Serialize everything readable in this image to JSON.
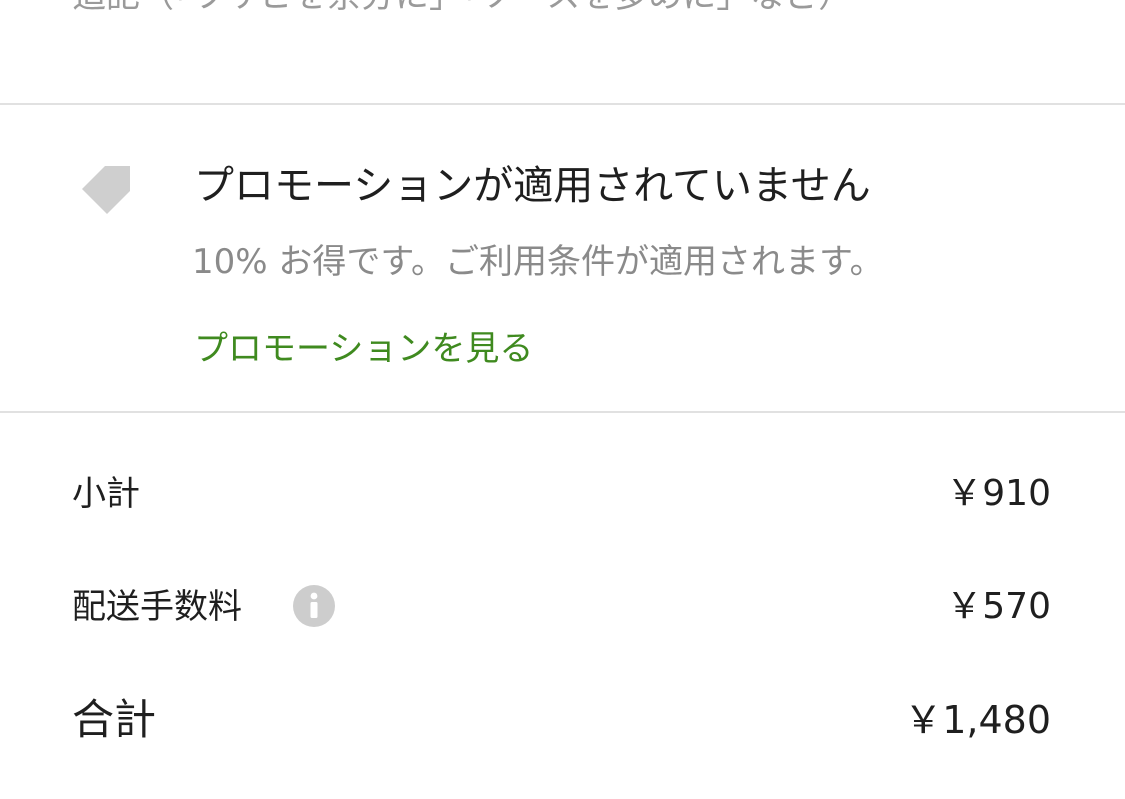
{
  "note": {
    "text": "追記（「ワサビを余分に」「ソースを多めに」など）"
  },
  "promotion": {
    "icon": "tag-icon",
    "title": "プロモーションが適用されていません",
    "description": "10% お得です。ご利用条件が適用されます。",
    "link_label": "プロモーションを見る",
    "link_color": "#3f8a1f"
  },
  "summary": {
    "subtotal": {
      "label": "小計",
      "value": "￥910"
    },
    "delivery_fee": {
      "label": "配送手数料",
      "value": "￥570",
      "icon": "info-icon"
    },
    "total": {
      "label": "合計",
      "value": "￥1,480"
    }
  }
}
